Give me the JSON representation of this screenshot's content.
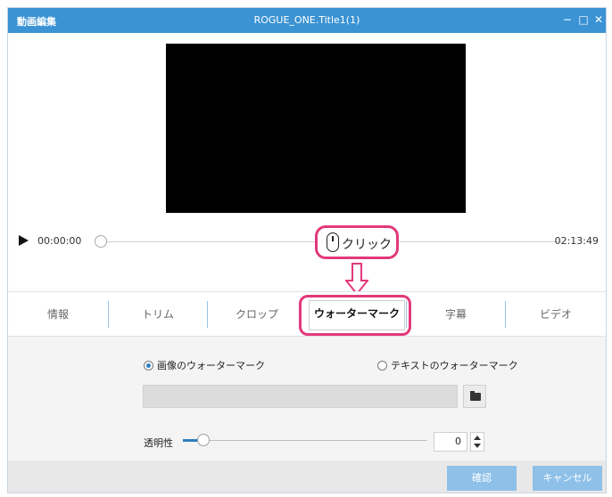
{
  "window": {
    "app_name": "動画編集",
    "title": "ROGUE_ONE.Title1(1)",
    "minimize_label": "−",
    "maximize_label": "□",
    "close_label": "✕"
  },
  "player": {
    "current_time": "00:00:00",
    "total_time": "02:13:49",
    "play_icon": "play-icon"
  },
  "callout": {
    "label": "クリック",
    "icon": "mouse-icon"
  },
  "tabs": [
    {
      "label": "情報"
    },
    {
      "label": "トリム"
    },
    {
      "label": "クロップ"
    },
    {
      "label": "ウォーターマーク",
      "active": true
    },
    {
      "label": "字幕"
    },
    {
      "label": "ビデオ"
    }
  ],
  "watermark": {
    "image_option": "画像のウォーターマーク",
    "text_option": "テキストのウォーターマーク",
    "selected": "image",
    "file_value": "",
    "opacity_label": "透明性",
    "opacity_value": "0"
  },
  "footer": {
    "confirm_label": "確認",
    "cancel_label": "キャンセル"
  },
  "colors": {
    "titlebar": "#3b93d4",
    "highlight": "#e2397a",
    "accent": "#2d7fc1",
    "button": "#8ec0e8"
  }
}
